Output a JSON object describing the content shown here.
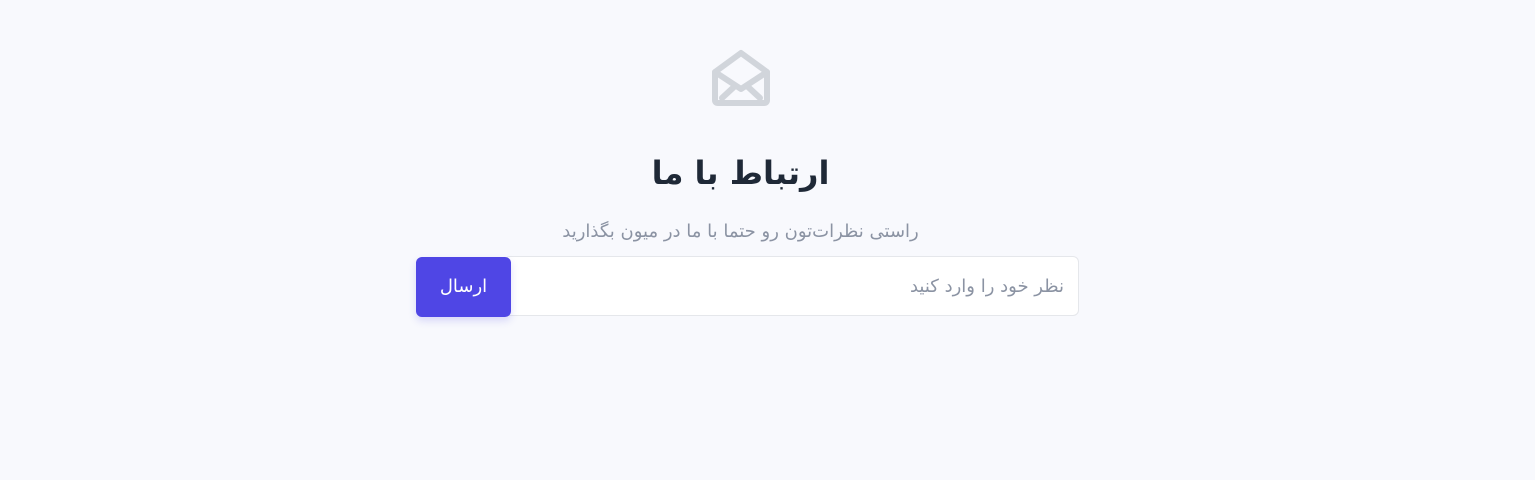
{
  "colors": {
    "background": "#f8f9fd",
    "accent": "#4f46e5",
    "heading": "#1f2937",
    "muted": "#8b93a3",
    "icon": "#d1d5db"
  },
  "hero": {
    "icon": "envelope-open-icon",
    "title": "ارتباط با ما",
    "subtitle": "راستی نظرات‌تون رو حتما با ما در میون بگذارید"
  },
  "form": {
    "input": {
      "value": "",
      "placeholder": "نظر خود را وارد کنید"
    },
    "send_label": "ارسال"
  }
}
